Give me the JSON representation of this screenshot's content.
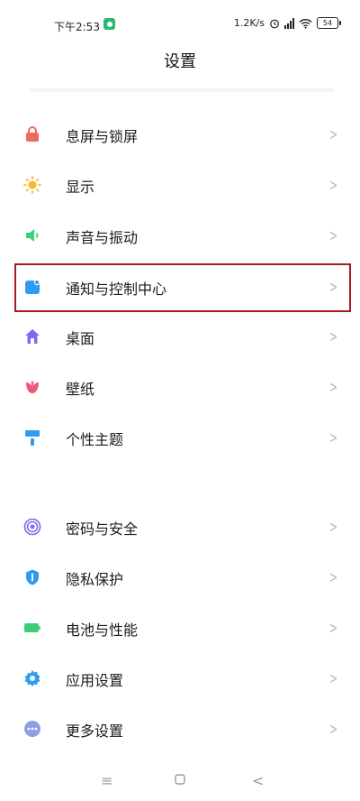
{
  "status_bar": {
    "time": "下午2:53",
    "speed": "1.2K/s",
    "battery": "54"
  },
  "header": {
    "title": "设置"
  },
  "items": [
    {
      "label": "息屏与锁屏",
      "icon": "lock-icon"
    },
    {
      "label": "显示",
      "icon": "sun-icon"
    },
    {
      "label": "声音与振动",
      "icon": "speaker-icon"
    },
    {
      "label": "通知与控制中心",
      "icon": "notification-icon"
    },
    {
      "label": "桌面",
      "icon": "home-icon"
    },
    {
      "label": "壁纸",
      "icon": "tulip-icon"
    },
    {
      "label": "个性主题",
      "icon": "paint-roller-icon"
    },
    {
      "label": "密码与安全",
      "icon": "fingerprint-icon"
    },
    {
      "label": "隐私保护",
      "icon": "shield-icon"
    },
    {
      "label": "电池与性能",
      "icon": "battery-icon"
    },
    {
      "label": "应用设置",
      "icon": "gear-icon"
    },
    {
      "label": "更多设置",
      "icon": "more-icon"
    }
  ],
  "colors": {
    "lock": "#f06a5a",
    "sun": "#f7b733",
    "speaker": "#3ccf7a",
    "notification": "#2e9bf0",
    "home": "#7a6cf0",
    "tulip": "#f0567a",
    "paint": "#2e9bf0",
    "fingerprint": "#7a6cf0",
    "shield": "#2e9bf0",
    "battery": "#3ccf7a",
    "gear": "#2e9bf0",
    "more": "#8aa0e0",
    "highlight": "#a51c1c"
  }
}
